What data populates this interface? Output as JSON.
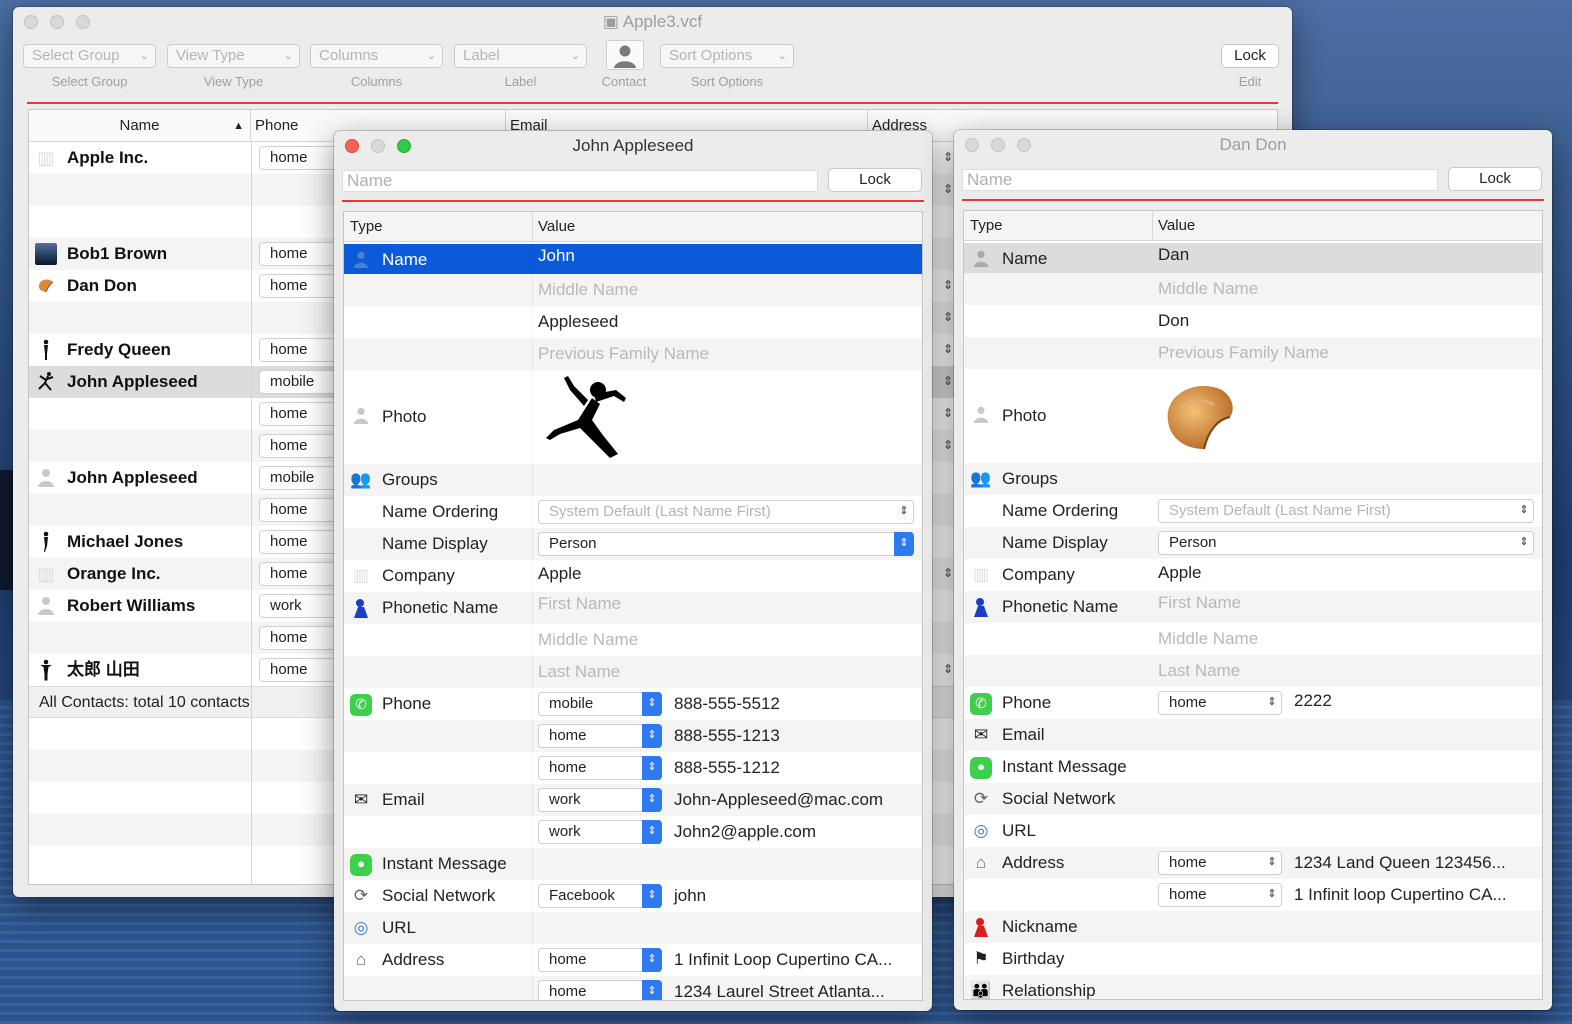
{
  "main_window": {
    "title": "Apple3.vcf",
    "toolbar": [
      {
        "value": "Select Group",
        "label": "Select Group"
      },
      {
        "value": "View Type",
        "label": "View Type"
      },
      {
        "value": "Columns",
        "label": "Columns"
      },
      {
        "value": "Label",
        "label": "Label"
      }
    ],
    "contact_label": "Contact",
    "sort_value": "Sort Options",
    "sort_label": "Sort Options",
    "lock_label": "Lock",
    "edit_label": "Edit",
    "columns": {
      "name": "Name",
      "phone": "Phone",
      "email": "Email",
      "address": "Address"
    },
    "rows": [
      {
        "name": "Apple Inc.",
        "phone_label": "home",
        "icon": "building-icon"
      },
      {
        "name": "",
        "phone_label": ""
      },
      {
        "name": "",
        "phone_label": ""
      },
      {
        "name": "Bob1 Brown",
        "phone_label": "home",
        "icon": "landscape-icon"
      },
      {
        "name": "Dan Don",
        "phone_label": "home",
        "icon": "fortune-cookie-icon"
      },
      {
        "name": "",
        "phone_label": ""
      },
      {
        "name": "Fredy Queen",
        "phone_label": "home",
        "icon": "silhouette-icon"
      },
      {
        "name": "John Appleseed",
        "phone_label": "mobile",
        "icon": "jumping-man-icon",
        "selected": true
      },
      {
        "name": "",
        "phone_label": "home"
      },
      {
        "name": "",
        "phone_label": "home"
      },
      {
        "name": "John Appleseed",
        "phone_label": "mobile",
        "icon": "person-icon"
      },
      {
        "name": "",
        "phone_label": "home"
      },
      {
        "name": "Michael Jones",
        "phone_label": "home",
        "icon": "silhouette-icon"
      },
      {
        "name": "Orange Inc.",
        "phone_label": "home",
        "icon": "building-icon"
      },
      {
        "name": "Robert Williams",
        "phone_label": "work",
        "icon": "person-icon"
      },
      {
        "name": "",
        "phone_label": "home"
      },
      {
        "name": "太郎 山田",
        "phone_label": "home",
        "icon": "silhouette-icon"
      }
    ],
    "status": "All Contacts: total 10 contacts"
  },
  "john_window": {
    "title": "John Appleseed",
    "name_placeholder": "Name",
    "lock_label": "Lock",
    "col_type": "Type",
    "col_value": "Value",
    "name_type": "Name",
    "first": "John",
    "middle_ph": "Middle Name",
    "last": "Appleseed",
    "prev_family_ph": "Previous Family Name",
    "photo_type": "Photo",
    "groups_type": "Groups",
    "name_ordering_type": "Name Ordering",
    "name_ordering_value": "System Default (Last Name First)",
    "name_display_type": "Name Display",
    "name_display_value": "Person",
    "company_type": "Company",
    "company_value": "Apple",
    "phonetic_type": "Phonetic Name",
    "phon_first_ph": "First Name",
    "phon_middle_ph": "Middle Name",
    "phon_last_ph": "Last Name",
    "phone_type": "Phone",
    "phones": [
      {
        "label": "mobile",
        "value": "888-555-5512"
      },
      {
        "label": "home",
        "value": "888-555-1213"
      },
      {
        "label": "home",
        "value": "888-555-1212"
      }
    ],
    "email_type": "Email",
    "emails": [
      {
        "label": "work",
        "value": "John-Appleseed@mac.com"
      },
      {
        "label": "work",
        "value": "John2@apple.com"
      }
    ],
    "im_type": "Instant Message",
    "social_type": "Social Network",
    "social_label": "Facebook",
    "social_value": "john",
    "url_type": "URL",
    "address_type": "Address",
    "addresses": [
      {
        "label": "home",
        "value": "1 Infinit Loop Cupertino CA..."
      },
      {
        "label": "home",
        "value": "1234 Laurel Street Atlanta..."
      }
    ]
  },
  "dan_window": {
    "title": "Dan Don",
    "name_placeholder": "Name",
    "lock_label": "Lock",
    "col_type": "Type",
    "col_value": "Value",
    "name_type": "Name",
    "first": "Dan",
    "middle_ph": "Middle Name",
    "last": "Don",
    "prev_family_ph": "Previous Family Name",
    "photo_type": "Photo",
    "groups_type": "Groups",
    "name_ordering_type": "Name Ordering",
    "name_ordering_value": "System Default (Last Name First)",
    "name_display_type": "Name Display",
    "name_display_value": "Person",
    "company_type": "Company",
    "company_value": "Apple",
    "phonetic_type": "Phonetic Name",
    "phon_first_ph": "First Name",
    "phon_middle_ph": "Middle Name",
    "phon_last_ph": "Last Name",
    "phone_type": "Phone",
    "phone_label": "home",
    "phone_value": "2222",
    "email_type": "Email",
    "im_type": "Instant Message",
    "social_type": "Social Network",
    "url_type": "URL",
    "address_type": "Address",
    "addresses": [
      {
        "label": "home",
        "value": "1234 Land Queen 123456..."
      },
      {
        "label": "home",
        "value": "1 Infinit loop Cupertino CA..."
      }
    ],
    "nickname_type": "Nickname",
    "birthday_type": "Birthday",
    "relationship_type": "Relationship"
  },
  "colors": {
    "accent": "#0b5ad8",
    "separator": "#e13b3b",
    "stepper": "#2c79f2"
  }
}
